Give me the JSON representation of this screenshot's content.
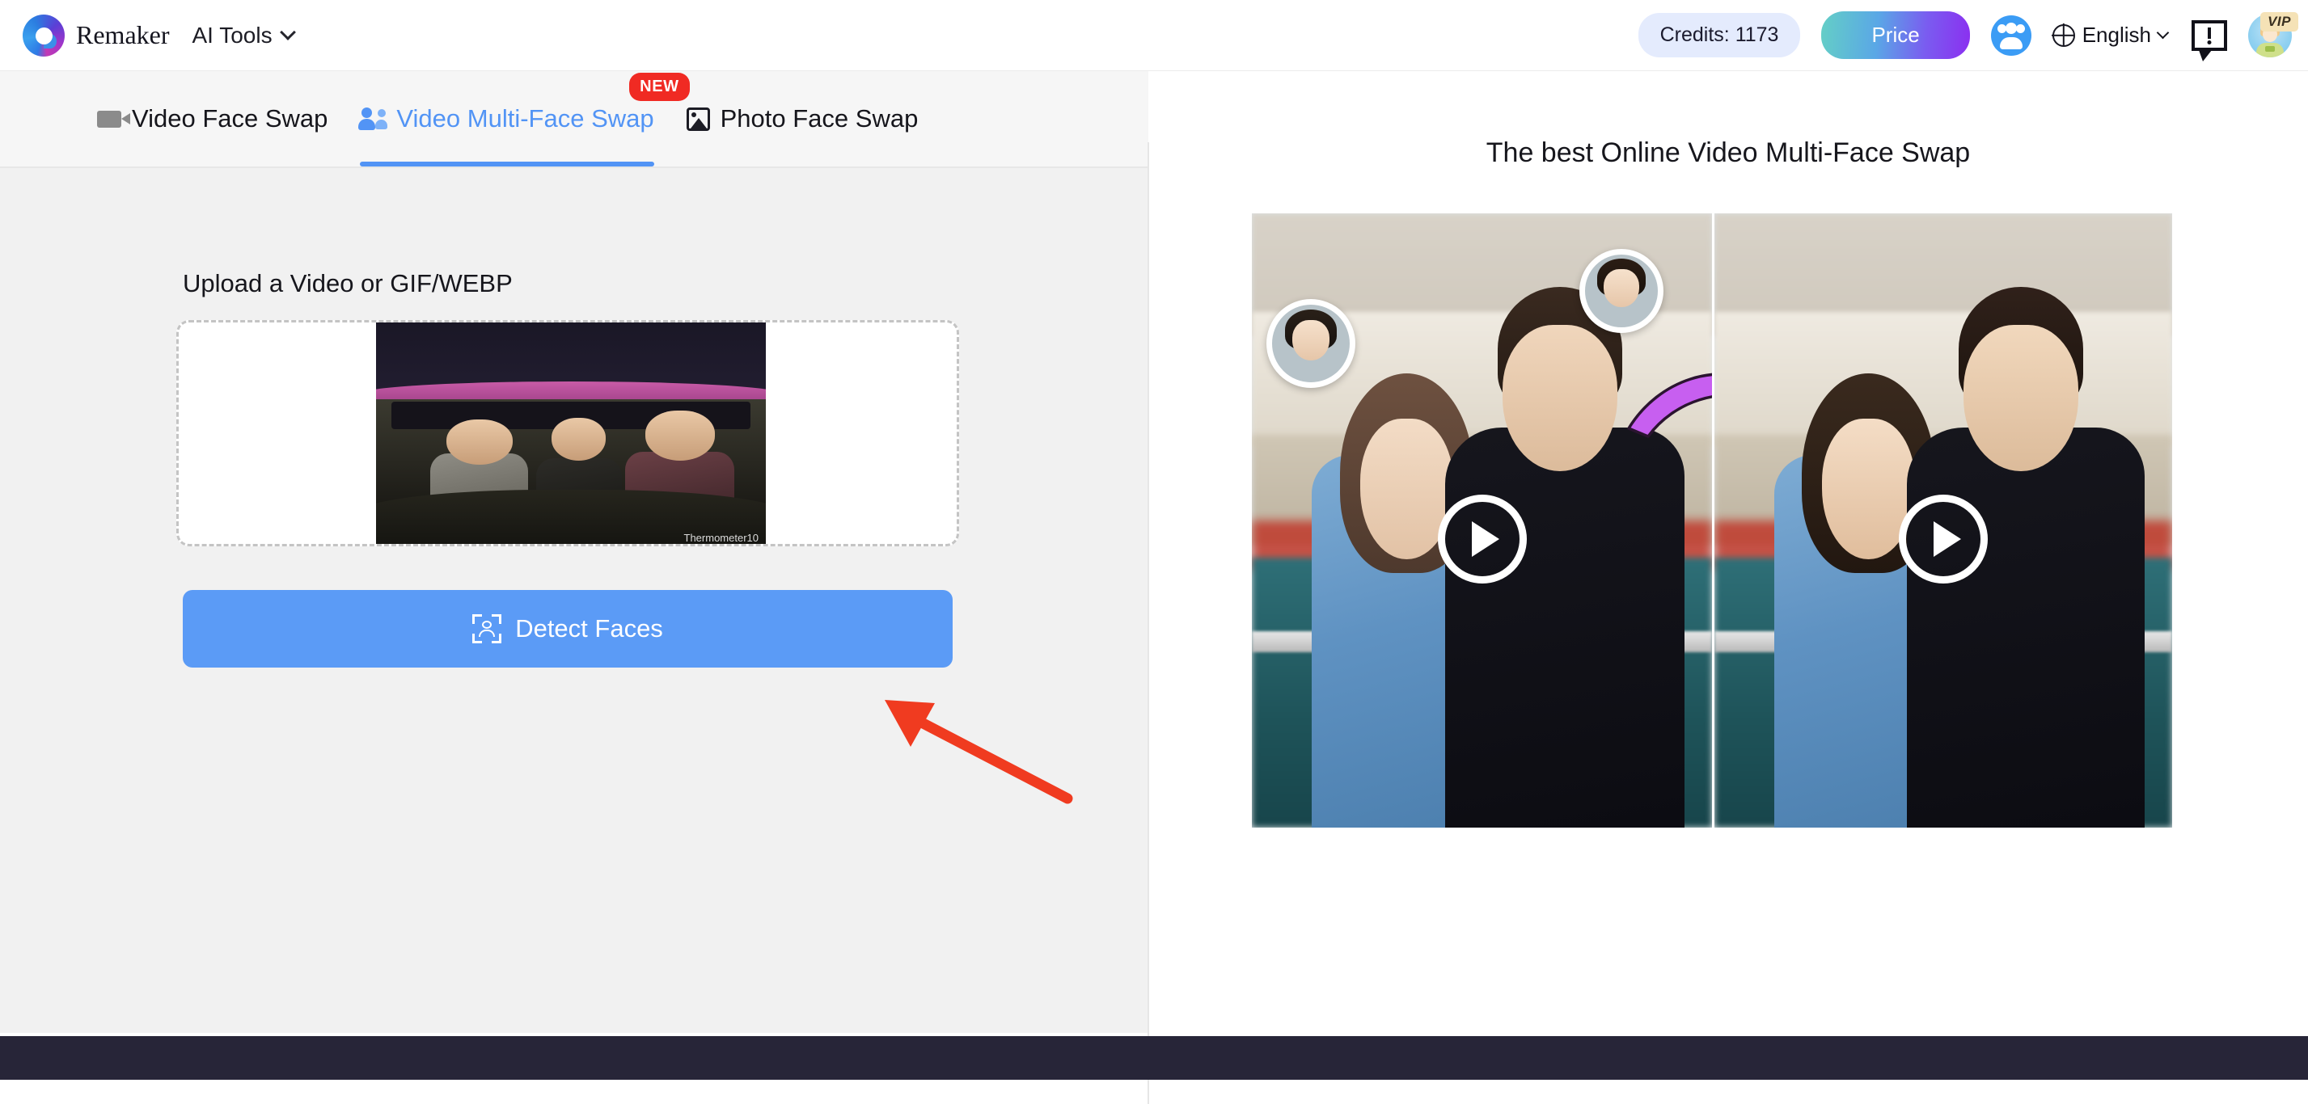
{
  "header": {
    "brand_name": "Remaker",
    "ai_tools_label": "AI Tools",
    "credits_label": "Credits: 1173",
    "price_label": "Price",
    "language_label": "English",
    "vip_badge": "VIP",
    "icons": {
      "logo": "remaker-logo-icon",
      "chevron": "chevron-down-icon",
      "affiliate": "affiliate-people-icon",
      "globe": "globe-icon",
      "feedback": "feedback-bubble-icon",
      "avatar": "user-avatar-icon"
    }
  },
  "tabs": [
    {
      "label": "Video Face Swap",
      "icon": "video-camera-icon",
      "active": false,
      "badge": ""
    },
    {
      "label": "Video Multi-Face Swap",
      "icon": "multi-person-icon",
      "active": true,
      "badge": "NEW"
    },
    {
      "label": "Photo Face Swap",
      "icon": "photo-image-icon",
      "active": false,
      "badge": ""
    }
  ],
  "upload": {
    "title": "Upload a Video or GIF/WEBP",
    "preview_watermark": "Thermometer10"
  },
  "actions": {
    "detect_faces_label": "Detect Faces",
    "detect_icon": "face-detect-icon"
  },
  "promo": {
    "title": "The best Online Video Multi-Face Swap",
    "play_icon": "play-button-icon",
    "swap_arrow_icon": "swap-arrow-icon"
  },
  "annotation": {
    "arrow_icon": "red-pointer-arrow-icon"
  },
  "colors": {
    "accent_blue": "#5294f5",
    "detect_button": "#5b9bf6",
    "credits_pill": "#e4ebfd",
    "new_badge": "#f02a23",
    "vip_badge": "#f5e2b6",
    "annotation_arrow": "#f03b20",
    "swap_arrow": "#c75ff0",
    "footer": "#272538",
    "left_panel": "#f1f1f1"
  }
}
